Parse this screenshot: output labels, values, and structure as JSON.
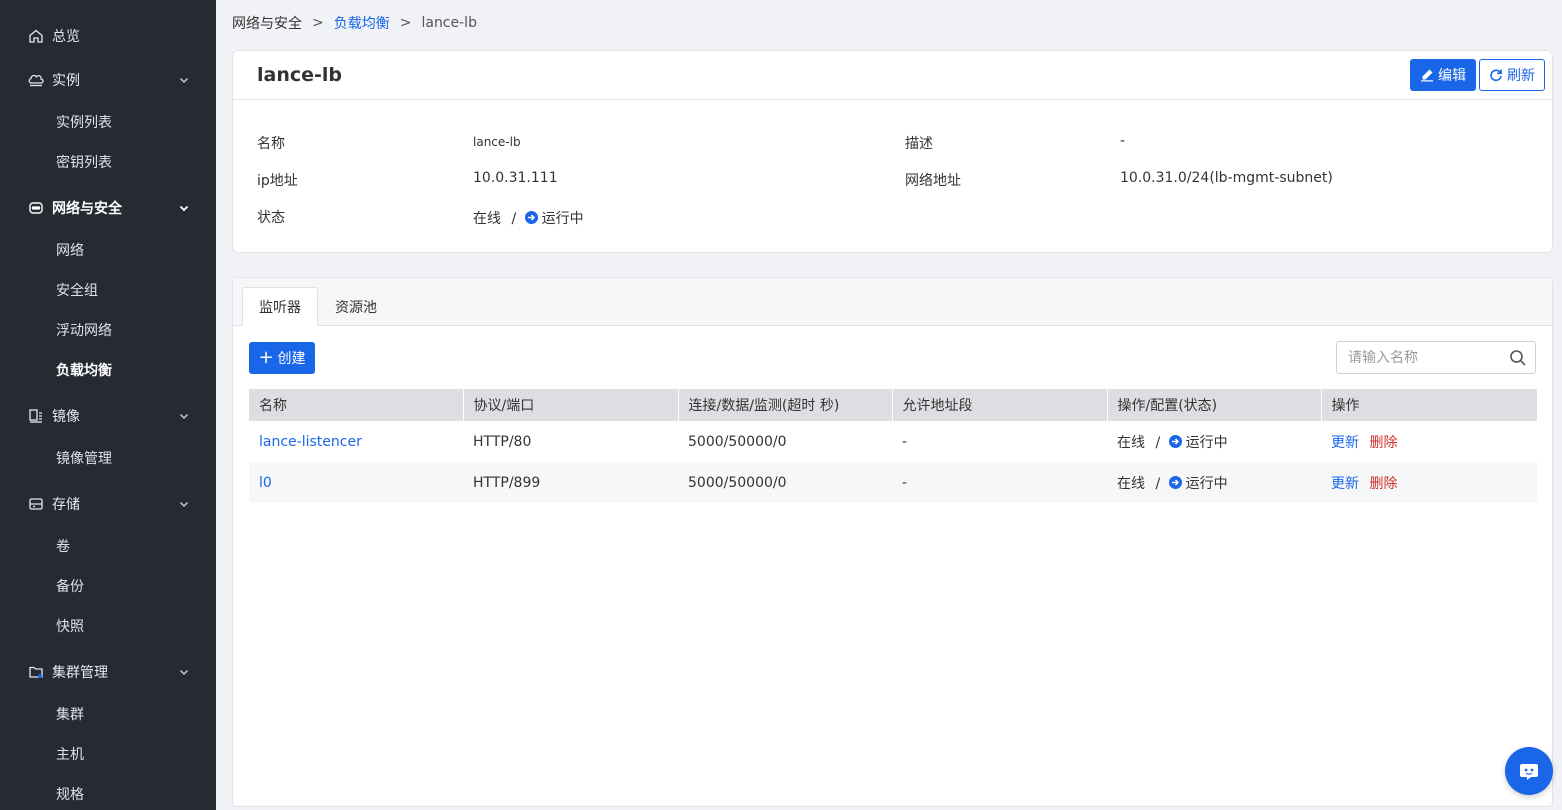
{
  "sidebar": {
    "items": [
      {
        "label": "总览",
        "icon": "home-icon"
      },
      {
        "label": "实例",
        "icon": "cloud-server-icon"
      },
      {
        "label": "网络与安全",
        "icon": "network-icon"
      },
      {
        "label": "镜像",
        "icon": "image-icon"
      },
      {
        "label": "存储",
        "icon": "storage-icon"
      },
      {
        "label": "集群管理",
        "icon": "cluster-folder-icon"
      }
    ],
    "sub": {
      "instance_list": "实例列表",
      "key_list": "密钥列表",
      "network": "网络",
      "security_group": "安全组",
      "floating_network": "浮动网络",
      "load_balance": "负载均衡",
      "image_manage": "镜像管理",
      "volume": "卷",
      "backup": "备份",
      "snapshot": "快照",
      "cluster": "集群",
      "host": "主机",
      "spec": "规格"
    }
  },
  "breadcrumb": {
    "level1": "网络与安全",
    "level2": "负载均衡",
    "current": "lance-lb",
    "separator": ">"
  },
  "detail": {
    "title": "lance-lb",
    "edit_label": "编辑",
    "refresh_label": "刷新",
    "fields": {
      "name_label": "名称",
      "name_value": "lance-lb",
      "desc_label": "描述",
      "desc_value": "-",
      "ip_label": "ip地址",
      "ip_value": "10.0.31.111",
      "net_label": "网络地址",
      "net_value": "10.0.31.0/24(lb-mgmt-subnet)",
      "status_label": "状态",
      "status_online": "在线",
      "status_sep": "/",
      "status_running": "运行中"
    }
  },
  "tabs": [
    {
      "label": "监听器",
      "active": true
    },
    {
      "label": "资源池",
      "active": false
    }
  ],
  "toolbar": {
    "create_label": "创建",
    "search_placeholder": "请输入名称"
  },
  "table": {
    "columns": [
      "名称",
      "协议/端口",
      "连接/数据/监测(超时 秒)",
      "允许地址段",
      "操作/配置(状态)",
      "操作"
    ],
    "rows": [
      {
        "name": "lance-listencer",
        "protocol": "HTTP/80",
        "conn": "5000/50000/0",
        "allowed": "-",
        "state_online": "在线",
        "state_sep": "/",
        "state_running": "运行中",
        "op_update": "更新",
        "op_delete": "删除"
      },
      {
        "name": "l0",
        "protocol": "HTTP/899",
        "conn": "5000/50000/0",
        "allowed": "-",
        "state_online": "在线",
        "state_sep": "/",
        "state_running": "运行中",
        "op_update": "更新",
        "op_delete": "删除"
      }
    ]
  },
  "colors": {
    "primary": "#1a66e8",
    "danger": "#d0302a",
    "sidebar_bg": "#262a33"
  }
}
